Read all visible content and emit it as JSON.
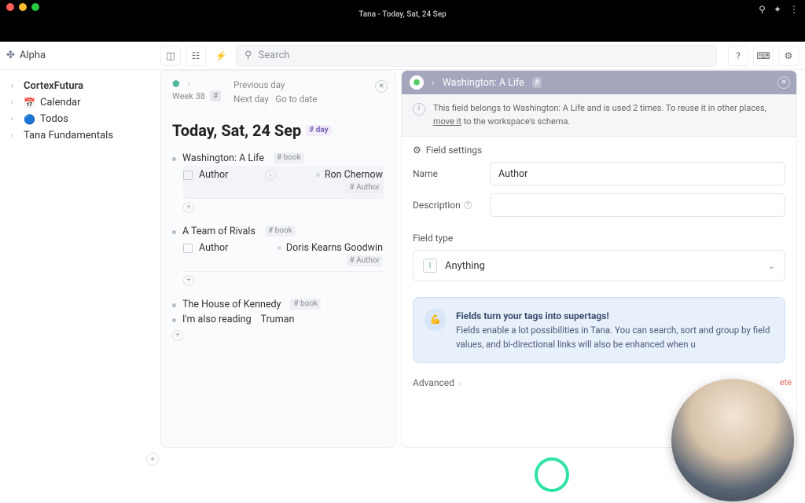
{
  "window": {
    "title": "Tana - Today, Sat, 24 Sep"
  },
  "header": {
    "workspace": "Alpha",
    "search_placeholder": "Search"
  },
  "sidebar": {
    "items": [
      {
        "label": "CortexFutura",
        "bold": true,
        "icon": ""
      },
      {
        "label": "Calendar",
        "icon": "📅"
      },
      {
        "label": "Todos",
        "icon": "🔵"
      },
      {
        "label": "Tana Fundamentals",
        "icon": ""
      }
    ]
  },
  "day": {
    "week": "Week 38",
    "nav": {
      "prev": "Previous day",
      "next": "Next day",
      "goto": "Go to date"
    },
    "title": "Today, Sat, 24 Sep",
    "tag": "# day",
    "items": [
      {
        "title": "Washington: A Life",
        "tag": "# book",
        "field": {
          "name": "Author",
          "value": "Ron Chernow",
          "valtag": "# Author"
        }
      },
      {
        "title": "A Team of Rivals",
        "tag": "# book",
        "field": {
          "name": "Author",
          "value": "Doris Kearns Goodwin",
          "valtag": "# Author"
        }
      },
      {
        "title": "The House of Kennedy",
        "tag": "# book"
      },
      {
        "title": "I'm also reading",
        "suffix": "Truman"
      }
    ]
  },
  "panel": {
    "breadcrumb": "Washington: A Life",
    "hash": "#",
    "notice_a": "This field belongs to Washington: A Life and is used 2 times. To reuse it in other places, ",
    "notice_link": "move it",
    "notice_b": " to the workspace's schema.",
    "section": "Field settings",
    "name_label": "Name",
    "name_value": "Author",
    "desc_label": "Description",
    "desc_value": "",
    "fieldtype_label": "Field type",
    "fieldtype_value": "Anything",
    "promo_title": "Fields turn your tags into supertags!",
    "promo_body": "Fields enable a lot possibilities in Tana. You can search, sort and group by field values, and bi-directional links will also be enhanced when u",
    "advanced": "Advanced",
    "delete": "ete"
  }
}
